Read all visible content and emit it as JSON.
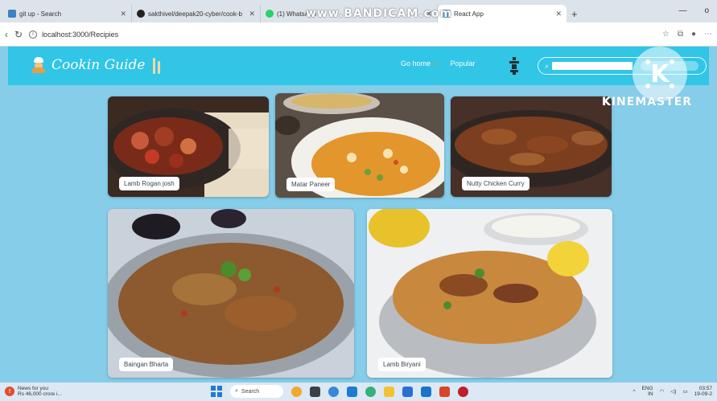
{
  "browser": {
    "tabs": [
      {
        "label": "git up - Search",
        "fav_color": "#3b82c4",
        "active": false
      },
      {
        "label": "sakthivel/deepak20-cyber/cook-b",
        "fav_color": "#222222",
        "active": false
      },
      {
        "label": "(1) WhatsApp",
        "fav_color": "#25d366",
        "active": false
      },
      {
        "label": "React App",
        "fav_color": "#5aa9d6",
        "active": true
      }
    ],
    "new_tab": "+",
    "address": "localhost:3000/Recipies",
    "window_controls": [
      "—",
      "o"
    ]
  },
  "overlays": {
    "recorder_watermark": "www.BANDICAM.com",
    "editor_watermark": "KINEMASTER",
    "editor_logo_letter": "K"
  },
  "app": {
    "brand": "Cookin Guide",
    "nav": {
      "home": "Go home",
      "popular": "Popular"
    },
    "search": {
      "placeholder": ""
    },
    "recipes": [
      {
        "title": "Lamb Rogan josh"
      },
      {
        "title": "Matar Paneer"
      },
      {
        "title": "Nutty Chicken Curry"
      },
      {
        "title": "Baingan Bharta"
      },
      {
        "title": "Lamb Biryani"
      }
    ]
  },
  "taskbar": {
    "news_title": "News for you",
    "news_sub": "Rs 46,000 crore i...",
    "search": "Search",
    "lang": "ENG",
    "lang_sub": "IN",
    "time": "03:57",
    "date": "19-09-2"
  },
  "colors": {
    "navbar": "#31c5e6",
    "page_bg": "#86cdea"
  }
}
